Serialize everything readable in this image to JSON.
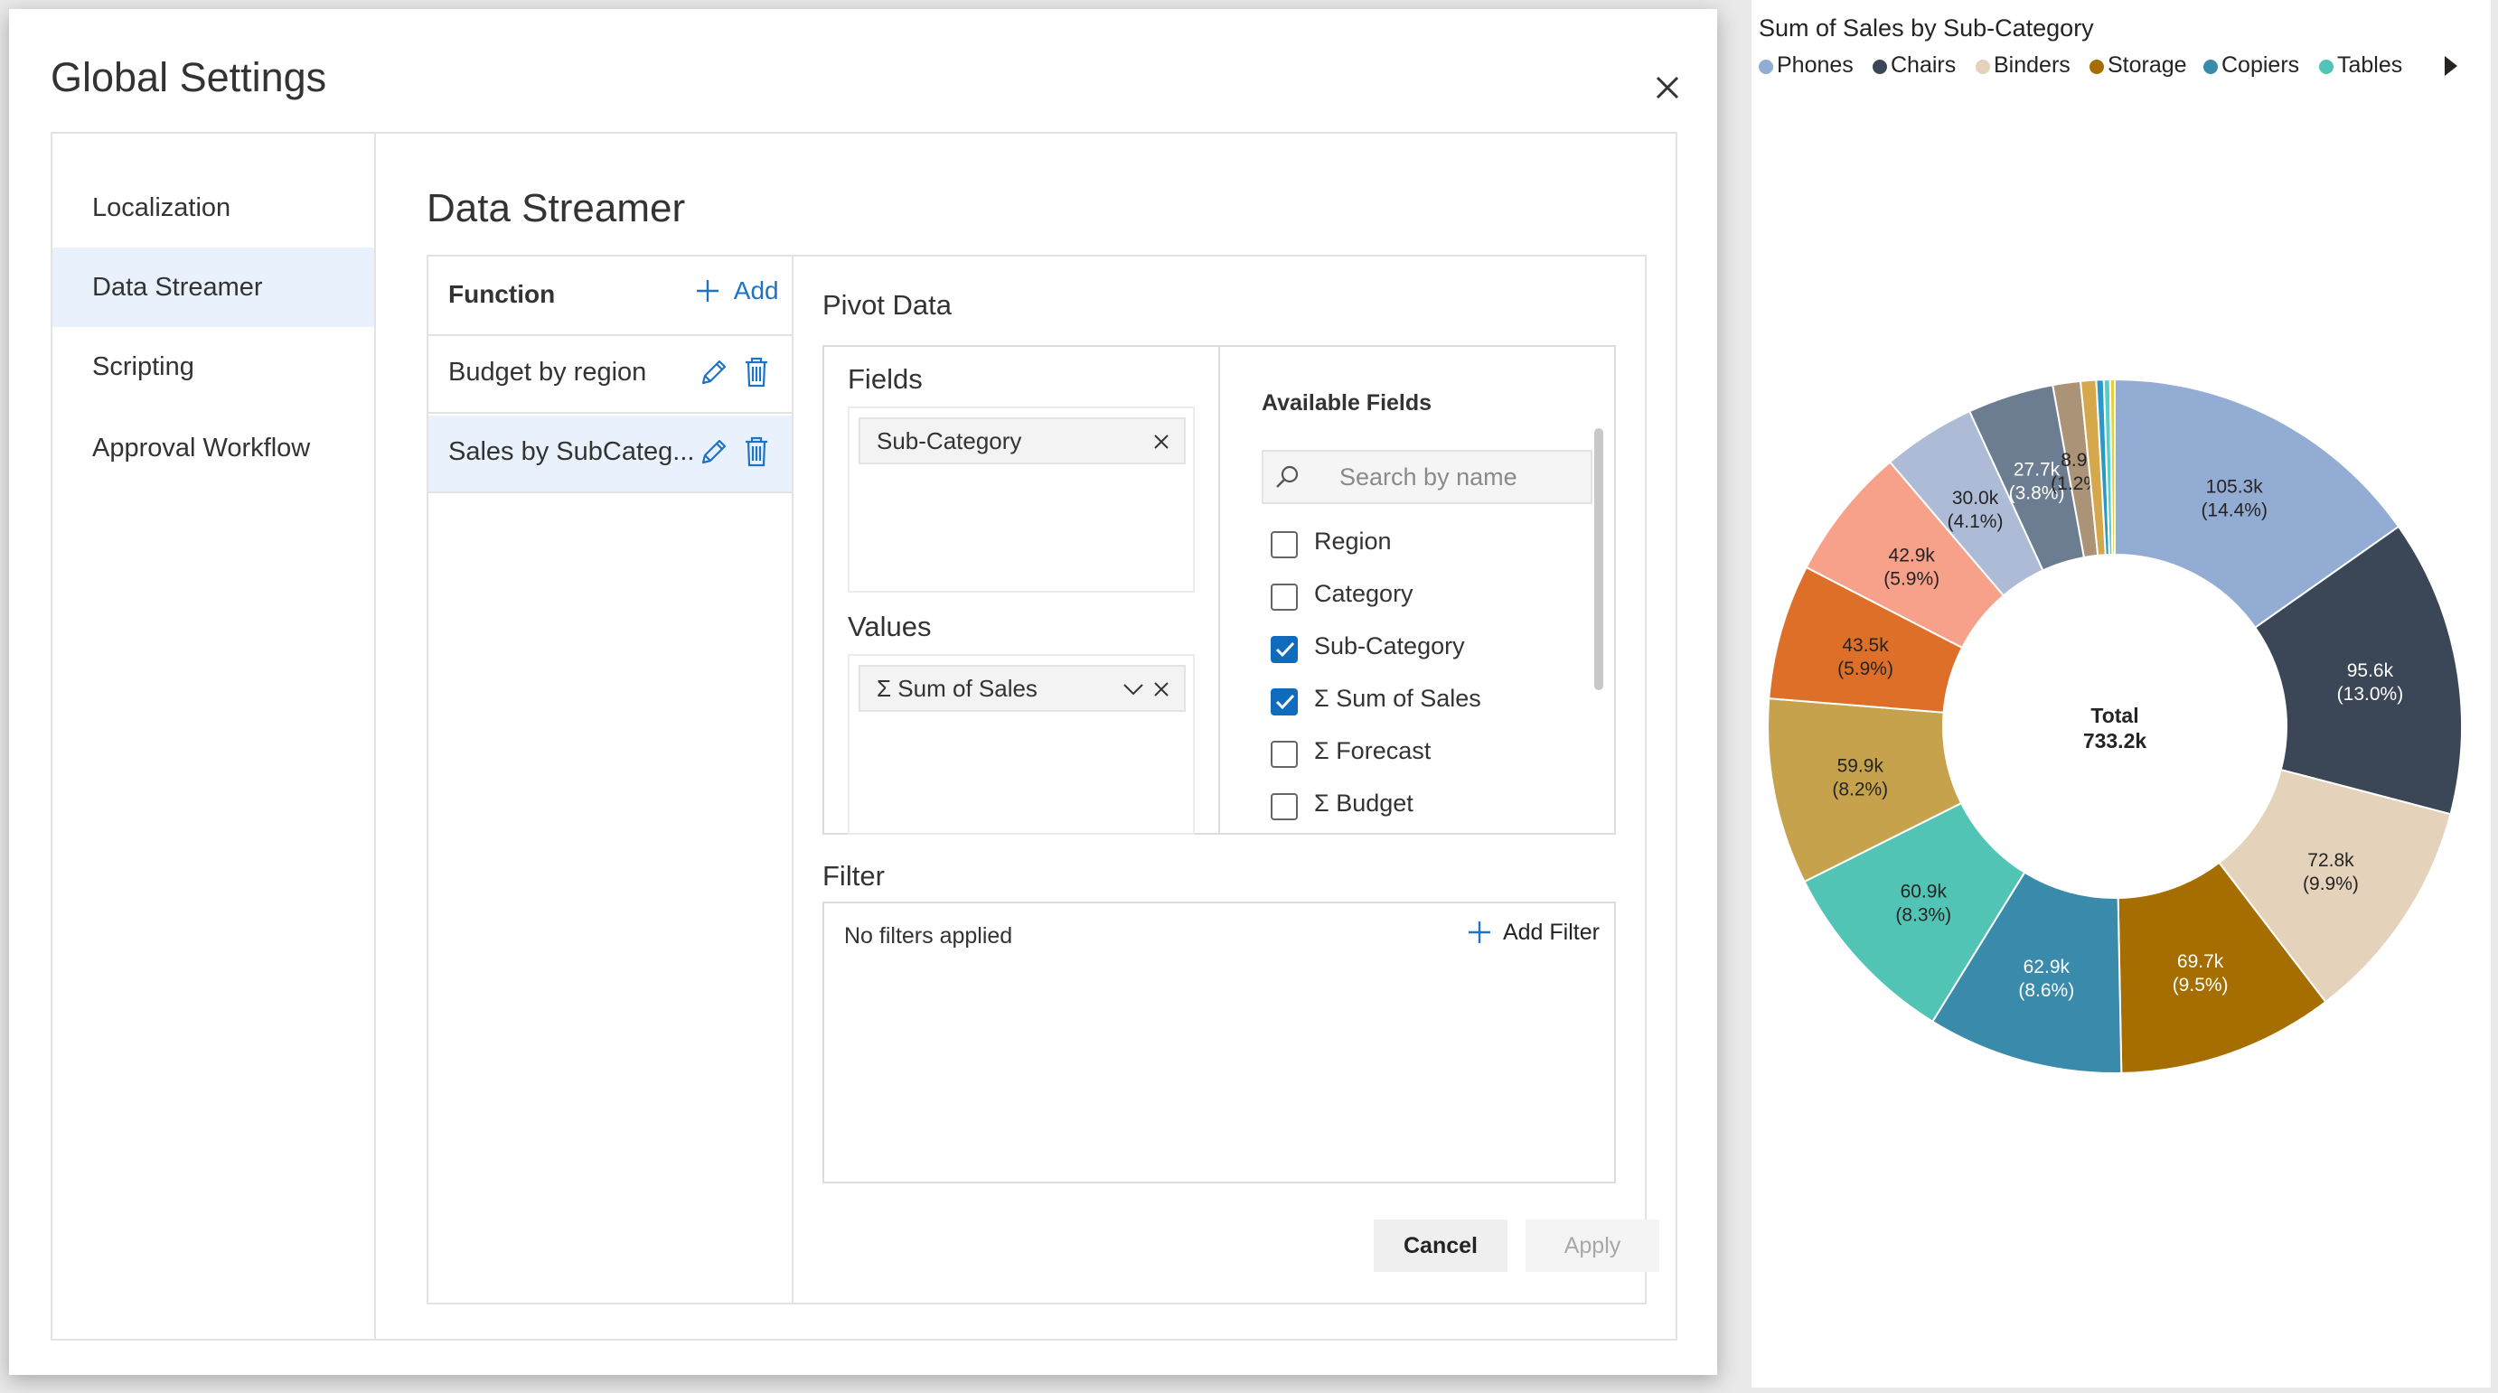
{
  "dialog": {
    "title": "Global Settings",
    "nav": [
      {
        "label": "Localization",
        "active": false
      },
      {
        "label": "Data Streamer",
        "active": true
      },
      {
        "label": "Scripting",
        "active": false
      },
      {
        "label": "Approval Workflow",
        "active": false
      }
    ],
    "section_title": "Data Streamer",
    "functions": {
      "header": "Function",
      "add_label": "Add",
      "items": [
        {
          "label": "Budget by region",
          "selected": false
        },
        {
          "label": "Sales by SubCateg...",
          "selected": true
        }
      ]
    },
    "pivot": {
      "title": "Pivot Data",
      "fields_title": "Fields",
      "fields": [
        "Sub-Category"
      ],
      "values_title": "Values",
      "values": [
        "Σ Sum of Sales"
      ],
      "available_title": "Available Fields",
      "search_placeholder": "Search by name",
      "available": [
        {
          "label": "Region",
          "checked": false
        },
        {
          "label": "Category",
          "checked": false
        },
        {
          "label": "Sub-Category",
          "checked": true
        },
        {
          "label": "Σ Sum of Sales",
          "checked": true
        },
        {
          "label": "Σ Forecast",
          "checked": false
        },
        {
          "label": "Σ Budget",
          "checked": false
        }
      ]
    },
    "filter": {
      "title": "Filter",
      "empty_text": "No filters applied",
      "add_label": "Add Filter"
    },
    "buttons": {
      "cancel": "Cancel",
      "apply": "Apply"
    }
  },
  "chart_data": {
    "type": "pie",
    "title": "Sum of Sales by Sub-Category",
    "center_label": "Total",
    "center_value": "733.2k",
    "legend_position": "top",
    "legend": [
      {
        "name": "Phones",
        "color": "#93acd3"
      },
      {
        "name": "Chairs",
        "color": "#3b4657"
      },
      {
        "name": "Binders",
        "color": "#e4d2ba"
      },
      {
        "name": "Storage",
        "color": "#a66e00"
      },
      {
        "name": "Copiers",
        "color": "#3a8aab"
      },
      {
        "name": "Tables",
        "color": "#52c4b6"
      }
    ],
    "slices": [
      {
        "value": 105.3,
        "label": "105.3k",
        "pct": "(14.4%)",
        "color": "#93acd3",
        "text_color": "#252423"
      },
      {
        "value": 95.6,
        "label": "95.6k",
        "pct": "(13.0%)",
        "color": "#3b4657",
        "text_color": "#ffffff"
      },
      {
        "value": 72.8,
        "label": "72.8k",
        "pct": "(9.9%)",
        "color": "#e4d2ba",
        "text_color": "#252423"
      },
      {
        "value": 69.7,
        "label": "69.7k",
        "pct": "(9.5%)",
        "color": "#a66e00",
        "text_color": "#ffffff"
      },
      {
        "value": 62.9,
        "label": "62.9k",
        "pct": "(8.6%)",
        "color": "#3a8aab",
        "text_color": "#ffffff"
      },
      {
        "value": 60.9,
        "label": "60.9k",
        "pct": "(8.3%)",
        "color": "#52c4b6",
        "text_color": "#252423"
      },
      {
        "value": 59.9,
        "label": "59.9k",
        "pct": "(8.2%)",
        "color": "#c7a24c",
        "text_color": "#252423"
      },
      {
        "value": 43.5,
        "label": "43.5k",
        "pct": "(5.9%)",
        "color": "#de6f29",
        "text_color": "#252423"
      },
      {
        "value": 42.9,
        "label": "42.9k",
        "pct": "(5.9%)",
        "color": "#f7a08a",
        "text_color": "#252423"
      },
      {
        "value": 30.0,
        "label": "30.0k",
        "pct": "(4.1%)",
        "color": "#adbbd6",
        "text_color": "#252423"
      },
      {
        "value": 27.7,
        "label": "27.7k",
        "pct": "(3.8%)",
        "color": "#6d7d91",
        "text_color": "#ffffff"
      },
      {
        "value": 8.9,
        "label": "8.9k",
        "pct": "(1.2%)",
        "color": "#ab9377",
        "text_color": "#252423"
      },
      {
        "value": 5.0,
        "label": "",
        "pct": "",
        "color": "#d6a84c",
        "text_color": "#252423"
      },
      {
        "value": 2.4,
        "label": "",
        "pct": "",
        "color": "#2c98c8",
        "text_color": "#252423"
      },
      {
        "value": 2.0,
        "label": "",
        "pct": "",
        "color": "#54d1c6",
        "text_color": "#252423"
      },
      {
        "value": 1.5,
        "label": "",
        "pct": "",
        "color": "#e4cf3d",
        "text_color": "#252423"
      }
    ]
  }
}
